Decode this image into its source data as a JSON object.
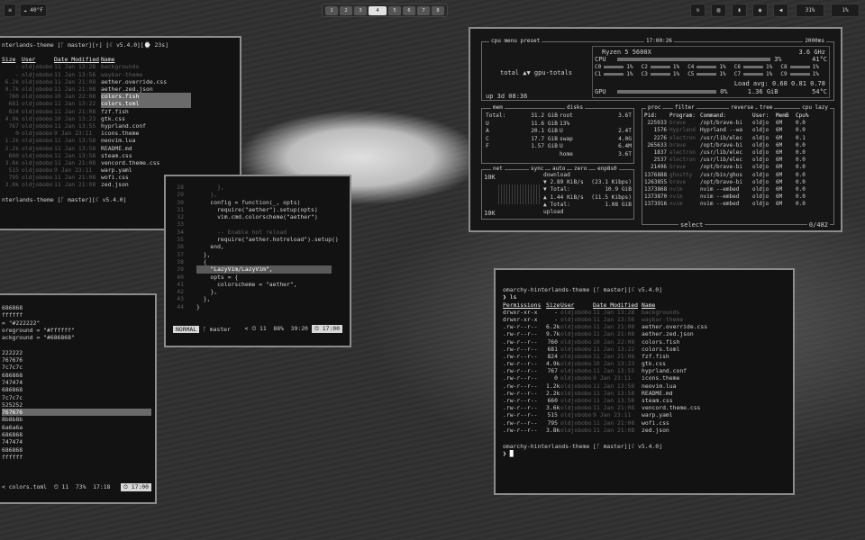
{
  "topbar": {
    "left": [
      "≡",
      "☁ 40°F"
    ],
    "workspaces": [
      "1",
      "2",
      "3",
      "4",
      "5",
      "6",
      "7",
      "8"
    ],
    "active_workspace": "4",
    "right": {
      "icons": [
        "exit-icon",
        "clipboard-icon",
        "mic-icon",
        "lightbulb-icon",
        "volume-icon"
      ],
      "battery": "31%",
      "brightness": "1%"
    }
  },
  "win1": {
    "prompt": "nterlands-theme [ᚴ master][↑] [☾ v5.4.0][⌚ 23s]",
    "headers": [
      "Size",
      "User",
      "Date Modified",
      "Name"
    ],
    "rows": [
      [
        "-",
        "oldjobobo",
        "11 Jan 13:28",
        "backgrounds",
        "dim"
      ],
      [
        "-",
        "oldjobobo",
        "11 Jan 13:56",
        "waybar-theme",
        "dim"
      ],
      [
        "6.2k",
        "oldjobobo",
        "11 Jan 21:08",
        "aether.override.css",
        ""
      ],
      [
        "9.7k",
        "oldjobobo",
        "11 Jan 21:08",
        "aether.zed.json",
        ""
      ],
      [
        "760",
        "oldjobobo",
        "10 Jan 22:08",
        "colors.fish",
        "hi"
      ],
      [
        "681",
        "oldjobobo",
        "11 Jan 13:22",
        "colors.toml",
        "hi"
      ],
      [
        "824",
        "oldjobobo",
        "11 Jan 21:08",
        "fzf.fish",
        ""
      ],
      [
        "4.9k",
        "oldjobobo",
        "10 Jan 13:23",
        "gtk.css",
        ""
      ],
      [
        "767",
        "oldjobobo",
        "11 Jan 13:55",
        "hyprland.conf",
        ""
      ],
      [
        "0",
        "oldjobobo",
        "9 Jan 23:11",
        "icons.theme",
        ""
      ],
      [
        "1.2k",
        "oldjobobo",
        "11 Jan 13:58",
        "neovim.lua",
        ""
      ],
      [
        "2.2k",
        "oldjobobo",
        "11 Jan 13:58",
        "README.md",
        ""
      ],
      [
        "660",
        "oldjobobo",
        "11 Jan 13:58",
        "steam.css",
        ""
      ],
      [
        "3.6k",
        "oldjobobo",
        "11 Jan 21:08",
        "vencord.theme.css",
        ""
      ],
      [
        "515",
        "oldjobobo",
        "9 Jan 23:11",
        "warp.yaml",
        ""
      ],
      [
        "795",
        "oldjobobo",
        "11 Jan 21:08",
        "wofi.css",
        ""
      ],
      [
        "3.8k",
        "oldjobobo",
        "11 Jan 21:08",
        "zed.json",
        ""
      ]
    ],
    "prompt2": "nterlands-theme [ᚴ master][☾ v5.4.0]"
  },
  "win2": {
    "lines": [
      [
        "686868",
        ""
      ],
      [
        "ffffff",
        ""
      ],
      [
        "= \"#222222\"",
        ""
      ],
      [
        "oreground = \"#ffffff\"",
        ""
      ],
      [
        "ackground = \"#686868\"",
        ""
      ],
      [
        "",
        ""
      ],
      [
        "222222",
        ""
      ],
      [
        "767676",
        ""
      ],
      [
        "7c7c7c",
        ""
      ],
      [
        "686868",
        ""
      ],
      [
        "747474",
        ""
      ],
      [
        "686868",
        ""
      ],
      [
        "7c7c7c",
        ""
      ],
      [
        "525252",
        ""
      ],
      [
        "767676",
        "hi"
      ],
      [
        "8b8b8b",
        ""
      ],
      [
        "6a6a6a",
        ""
      ],
      [
        "686868",
        ""
      ],
      [
        "747474",
        ""
      ],
      [
        "686868",
        ""
      ],
      [
        "ffffff",
        ""
      ]
    ],
    "status": "< colors.toml  ⏲ 11  73%  17:18",
    "time": "17:00"
  },
  "editor": {
    "lines": [
      [
        "28",
        "      },",
        "dim"
      ],
      [
        "29",
        "    },",
        "dim"
      ],
      [
        "30",
        "    config = function(_, opts)",
        ""
      ],
      [
        "31",
        "      require(\"aether\").setup(opts)",
        ""
      ],
      [
        "32",
        "      vim.cmd.colorscheme(\"aether\")",
        ""
      ],
      [
        "33",
        "",
        ""
      ],
      [
        "34",
        "      -- Enable hot reload",
        "dim"
      ],
      [
        "35",
        "      require(\"aether.hotreload\").setup()",
        ""
      ],
      [
        "36",
        "    end,",
        ""
      ],
      [
        "37",
        "  },",
        ""
      ],
      [
        "38",
        "  {",
        ""
      ],
      [
        "39",
        "    \"LazyVim/LazyVim\",",
        "hi"
      ],
      [
        "40",
        "    opts = {",
        ""
      ],
      [
        "41",
        "      colorscheme = \"aether\",",
        ""
      ],
      [
        "42",
        "    },",
        ""
      ],
      [
        "43",
        "  },",
        ""
      ],
      [
        "44",
        "}",
        ""
      ]
    ],
    "mode": "NORMAL",
    "branch": "ᚴ master",
    "info": "< ⏲ 11  88%  39:20",
    "time": "17:00"
  },
  "btop": {
    "cpu_box": {
      "tabs": "cpu   menu   preset",
      "time": "17:00:26",
      "rate": "2000ms",
      "model": "Ryzen 5 5600X",
      "freq": "3.6 GHz",
      "temp": "41°C",
      "cpu_label": "CPU",
      "cpu_pct": "3%",
      "cores": [
        [
          "C0",
          "1%"
        ],
        [
          "C2",
          "1%"
        ],
        [
          "C4",
          "1%"
        ],
        [
          "C6",
          "1%"
        ],
        [
          "C8",
          "1%"
        ],
        [
          "C1",
          "1%"
        ],
        [
          "C3",
          "1%"
        ],
        [
          "C5",
          "1%"
        ],
        [
          "C7",
          "1%"
        ],
        [
          "C9",
          "1%"
        ]
      ],
      "load": "Load avg: 0.68 0.81 0.78",
      "gpu_label": "GPU",
      "gpu_pct": "0%",
      "gpu_mem": "1.36 GiB",
      "gpu_temp": "54°C",
      "gpu_tabs": "total ▲▼ gpu-totals",
      "uptime": "up 3d 08:36"
    },
    "mem_box": {
      "label": "mem",
      "disks": "disks",
      "rows": [
        [
          "Total:",
          "31.2 GiB"
        ],
        [
          "U",
          "11.6 GiB"
        ],
        [
          "A",
          "20.1 GiB"
        ],
        [
          "C",
          "17.7 GiB"
        ],
        [
          "F",
          "1.57 GiB"
        ]
      ],
      "disk_rows": [
        [
          "root",
          "3.6T"
        ],
        [
          "13%",
          ""
        ],
        [
          "U",
          "2.4T"
        ],
        [
          "swap",
          "4.0G"
        ],
        [
          "U",
          "6.4M"
        ],
        [
          "home",
          "3.6T"
        ]
      ]
    },
    "net_box": {
      "label": "net",
      "iface": "enp8s0",
      "sync": "sync",
      "auto": "auto",
      "zero": "zero",
      "scale_top": "10K",
      "scale_bottom": "10K",
      "rows": [
        [
          "download",
          ""
        ],
        [
          "▼ 2.89 KiB/s",
          "(23.1 Kibps)"
        ],
        [
          "▼ Total:",
          "10.9 GiB"
        ],
        [
          "▲ 1.44 KiB/s",
          "(11.5 Kibps)"
        ],
        [
          "▲ Total:",
          "1.08 GiB"
        ],
        [
          "upload",
          ""
        ]
      ]
    },
    "proc_box": {
      "label": "proc",
      "filter": "filter",
      "reverse": "reverse",
      "tree": "tree",
      "sort": "cpu lazy",
      "headers": [
        "Pid:",
        "Program:",
        "Command:",
        "User:",
        "MemB",
        "Cpu%"
      ],
      "rows": [
        [
          "225933",
          "brave",
          "/opt/brave-bi",
          "oldjo",
          "6M",
          "0.0"
        ],
        [
          "1576",
          "Hyprland",
          "Hyprland --wa",
          "oldjo",
          "6M",
          "0.0"
        ],
        [
          "2276",
          "electron",
          "/usr/lib/elec",
          "oldjo",
          "6M",
          "0.1"
        ],
        [
          "265633",
          "brave",
          "/opt/brave-bi",
          "oldjo",
          "6M",
          "0.0"
        ],
        [
          "1837",
          "electron",
          "/usr/lib/elec",
          "oldjo",
          "6M",
          "0.0"
        ],
        [
          "2537",
          "electron",
          "/usr/lib/elec",
          "oldjo",
          "6M",
          "0.0"
        ],
        [
          "21496",
          "brave",
          "/opt/brave-bi",
          "oldjo",
          "6M",
          "0.0"
        ],
        [
          "1376888",
          "ghostty",
          "/usr/bin/ghos",
          "oldjo",
          "6M",
          "0.0"
        ],
        [
          "1263855",
          "brave",
          "/opt/brave-bi",
          "oldjo",
          "6M",
          "0.0"
        ],
        [
          "1373868",
          "nvim",
          "nvim --embed",
          "oldjo",
          "6M",
          "0.0"
        ],
        [
          "1373870",
          "nvim",
          "nvim --embed",
          "oldjo",
          "6M",
          "0.0"
        ],
        [
          "1373916",
          "nvim",
          "nvim --embed",
          "oldjo",
          "6M",
          "0.0"
        ]
      ],
      "footer": "select",
      "count": "0/482"
    }
  },
  "win4": {
    "prompt": "omarchy-hinterlands-theme [ᚴ master][☾ v5.4.0]",
    "cmd": "❯ ls",
    "headers": [
      "Permissions",
      "Size",
      "User",
      "Date Modified",
      "Name"
    ],
    "rows": [
      [
        "drwxr-xr-x",
        "-",
        "oldjobobo",
        "11 Jan 13:28",
        "backgrounds",
        "dim"
      ],
      [
        "drwxr-xr-x",
        "-",
        "oldjobobo",
        "11 Jan 13:56",
        "waybar-theme",
        "dim"
      ],
      [
        ".rw-r--r--",
        "6.2k",
        "oldjobobo",
        "11 Jan 21:08",
        "aether.override.css",
        ""
      ],
      [
        ".rw-r--r--",
        "9.7k",
        "oldjobobo",
        "11 Jan 21:08",
        "aether.zed.json",
        ""
      ],
      [
        ".rw-r--r--",
        "760",
        "oldjobobo",
        "10 Jan 22:08",
        "colors.fish",
        ""
      ],
      [
        ".rw-r--r--",
        "681",
        "oldjobobo",
        "11 Jan 13:22",
        "colors.toml",
        ""
      ],
      [
        ".rw-r--r--",
        "824",
        "oldjobobo",
        "11 Jan 21:08",
        "fzf.fish",
        ""
      ],
      [
        ".rw-r--r--",
        "4.9k",
        "oldjobobo",
        "10 Jan 13:23",
        "gtk.css",
        ""
      ],
      [
        ".rw-r--r--",
        "767",
        "oldjobobo",
        "11 Jan 13:55",
        "hyprland.conf",
        ""
      ],
      [
        ".rw-r--r--",
        "0",
        "oldjobobo",
        "9 Jan 23:11",
        "icons.theme",
        ""
      ],
      [
        ".rw-r--r--",
        "1.2k",
        "oldjobobo",
        "11 Jan 13:58",
        "neovim.lua",
        ""
      ],
      [
        ".rw-r--r--",
        "2.2k",
        "oldjobobo",
        "11 Jan 13:58",
        "README.md",
        ""
      ],
      [
        ".rw-r--r--",
        "660",
        "oldjobobo",
        "11 Jan 13:58",
        "steam.css",
        ""
      ],
      [
        ".rw-r--r--",
        "3.6k",
        "oldjobobo",
        "11 Jan 21:08",
        "vencord.theme.css",
        ""
      ],
      [
        ".rw-r--r--",
        "515",
        "oldjobobo",
        "9 Jan 23:11",
        "warp.yaml",
        ""
      ],
      [
        ".rw-r--r--",
        "795",
        "oldjobobo",
        "11 Jan 21:08",
        "wofi.css",
        ""
      ],
      [
        ".rw-r--r--",
        "3.8k",
        "oldjobobo",
        "11 Jan 21:08",
        "zed.json",
        ""
      ]
    ],
    "prompt2": "omarchy-hinterlands-theme [ᚴ master][☾ v5.4.0]",
    "cmd2": "❯ █"
  }
}
